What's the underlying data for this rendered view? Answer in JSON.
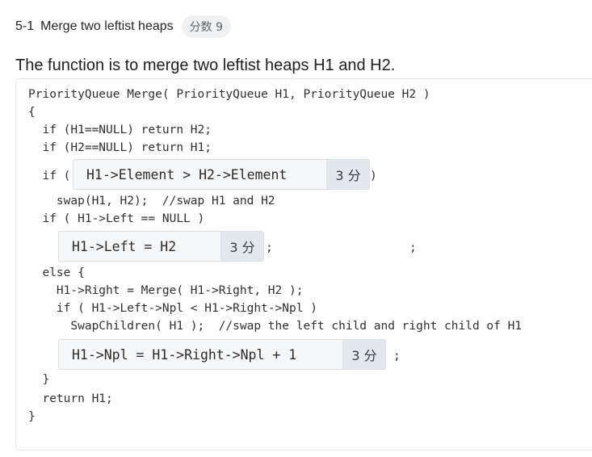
{
  "header": {
    "number": "5-1",
    "title": "Merge two leftist heaps",
    "score_badge": "分数 9"
  },
  "prompt": "The function is to merge two leftist heaps H1 and H2.",
  "code": {
    "line1": "PriorityQueue Merge( PriorityQueue H1, PriorityQueue H2 )",
    "line2": "{",
    "line3": "  if (H1==NULL) return H2;",
    "line4": "  if (H2==NULL) return H1;",
    "line5_pre": "  if (",
    "line5_post": ")",
    "line6": "    swap(H1, H2);  //swap H1 and H2",
    "line7": "  if ( H1->Left == NULL )",
    "line8_post": ";",
    "line8_tail": ";",
    "line9": "  else {",
    "line10": "    H1->Right = Merge( H1->Right, H2 );",
    "line11": "    if ( H1->Left->Npl < H1->Right->Npl )",
    "line12": "      SwapChildren( H1 );  //swap the left child and right child of H1",
    "line13_post": ";",
    "line14": "  }",
    "line15": "  return H1;",
    "line16": "}"
  },
  "blanks": [
    {
      "answer": "H1->Element > H2->Element",
      "points": "3 分"
    },
    {
      "answer": "H1->Left = H2",
      "points": "3 分"
    },
    {
      "answer": "H1->Npl = H1->Right->Npl + 1",
      "points": "3 分"
    }
  ]
}
